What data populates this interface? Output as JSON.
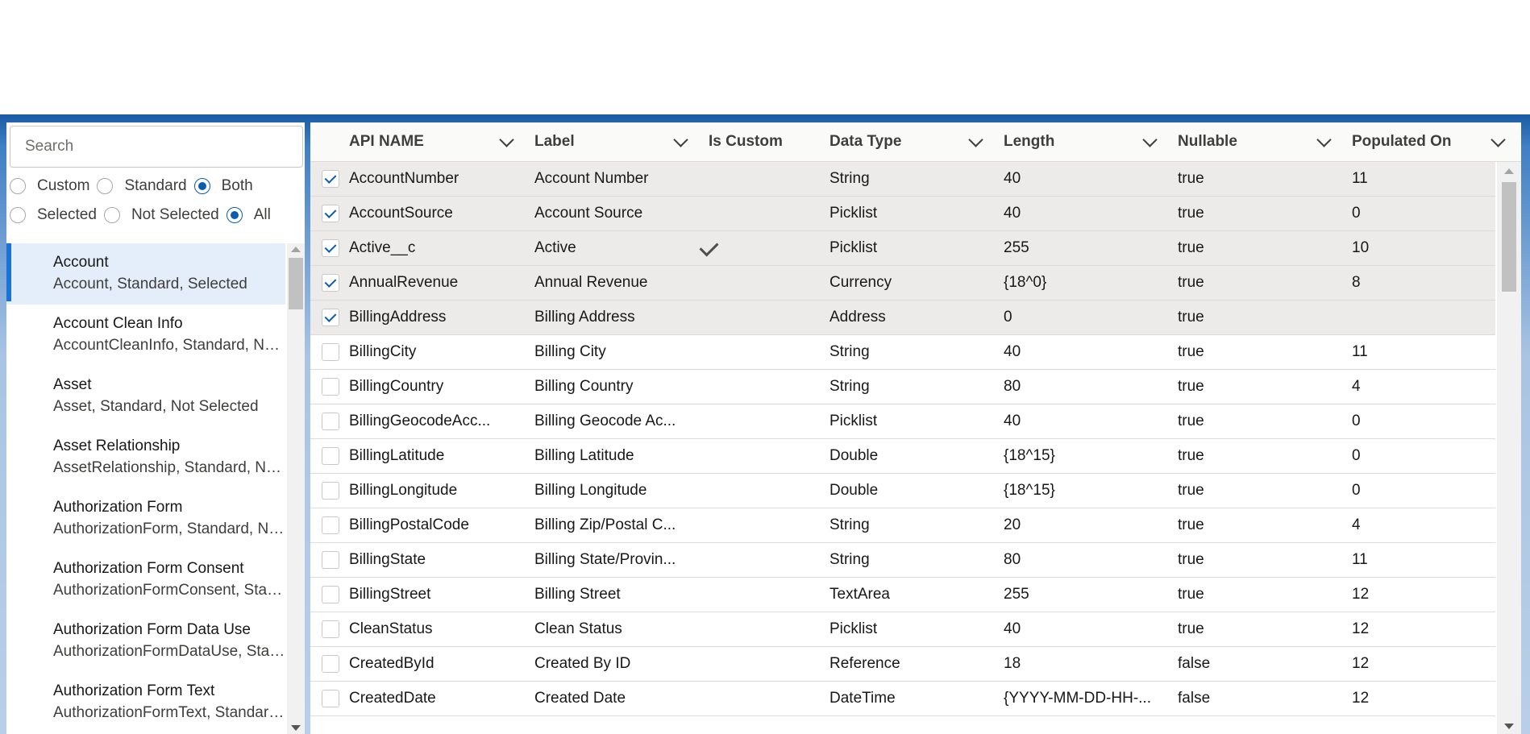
{
  "search": {
    "placeholder": "Search",
    "value": ""
  },
  "filters": {
    "type": [
      {
        "label": "Custom",
        "checked": false
      },
      {
        "label": "Standard",
        "checked": false
      },
      {
        "label": "Both",
        "checked": true
      }
    ],
    "selection": [
      {
        "label": "Selected",
        "checked": false
      },
      {
        "label": "Not Selected",
        "checked": false
      },
      {
        "label": "All",
        "checked": true
      }
    ]
  },
  "objects": [
    {
      "name": "Account",
      "desc": "Account, Standard, Selected",
      "active": true
    },
    {
      "name": "Account Clean Info",
      "desc": "AccountCleanInfo, Standard, Not Selected",
      "active": false
    },
    {
      "name": "Asset",
      "desc": "Asset, Standard, Not Selected",
      "active": false
    },
    {
      "name": "Asset Relationship",
      "desc": "AssetRelationship, Standard, Not Selected",
      "active": false
    },
    {
      "name": "Authorization Form",
      "desc": "AuthorizationForm, Standard, Not Selected",
      "active": false
    },
    {
      "name": "Authorization Form Consent",
      "desc": "AuthorizationFormConsent, Standard, Not Selected",
      "active": false
    },
    {
      "name": "Authorization Form Data Use",
      "desc": "AuthorizationFormDataUse, Standard, Not Selected",
      "active": false
    },
    {
      "name": "Authorization Form Text",
      "desc": "AuthorizationFormText, Standard, Not Selected",
      "active": false
    }
  ],
  "columns": [
    {
      "label": "API NAME",
      "sortable": true
    },
    {
      "label": "Label",
      "sortable": true
    },
    {
      "label": "Is Custom",
      "sortable": false
    },
    {
      "label": "Data Type",
      "sortable": true
    },
    {
      "label": "Length",
      "sortable": true
    },
    {
      "label": "Nullable",
      "sortable": true
    },
    {
      "label": "Populated On",
      "sortable": true
    }
  ],
  "rows": [
    {
      "selected": true,
      "api": "AccountNumber",
      "label": "Account Number",
      "custom": false,
      "type": "String",
      "length": "40",
      "nullable": "true",
      "populated": "11"
    },
    {
      "selected": true,
      "api": "AccountSource",
      "label": "Account Source",
      "custom": false,
      "type": "Picklist",
      "length": "40",
      "nullable": "true",
      "populated": "0"
    },
    {
      "selected": true,
      "api": "Active__c",
      "label": "Active",
      "custom": true,
      "type": "Picklist",
      "length": "255",
      "nullable": "true",
      "populated": "10"
    },
    {
      "selected": true,
      "api": "AnnualRevenue",
      "label": "Annual Revenue",
      "custom": false,
      "type": "Currency",
      "length": "{18^0}",
      "nullable": "true",
      "populated": "8"
    },
    {
      "selected": true,
      "api": "BillingAddress",
      "label": "Billing Address",
      "custom": false,
      "type": "Address",
      "length": "0",
      "nullable": "true",
      "populated": ""
    },
    {
      "selected": false,
      "api": "BillingCity",
      "label": "Billing City",
      "custom": false,
      "type": "String",
      "length": "40",
      "nullable": "true",
      "populated": "11"
    },
    {
      "selected": false,
      "api": "BillingCountry",
      "label": "Billing Country",
      "custom": false,
      "type": "String",
      "length": "80",
      "nullable": "true",
      "populated": "4"
    },
    {
      "selected": false,
      "api": "BillingGeocodeAcc...",
      "label": "Billing Geocode Ac...",
      "custom": false,
      "type": "Picklist",
      "length": "40",
      "nullable": "true",
      "populated": "0"
    },
    {
      "selected": false,
      "api": "BillingLatitude",
      "label": "Billing Latitude",
      "custom": false,
      "type": "Double",
      "length": "{18^15}",
      "nullable": "true",
      "populated": "0"
    },
    {
      "selected": false,
      "api": "BillingLongitude",
      "label": "Billing Longitude",
      "custom": false,
      "type": "Double",
      "length": "{18^15}",
      "nullable": "true",
      "populated": "0"
    },
    {
      "selected": false,
      "api": "BillingPostalCode",
      "label": "Billing Zip/Postal C...",
      "custom": false,
      "type": "String",
      "length": "20",
      "nullable": "true",
      "populated": "4"
    },
    {
      "selected": false,
      "api": "BillingState",
      "label": "Billing State/Provin...",
      "custom": false,
      "type": "String",
      "length": "80",
      "nullable": "true",
      "populated": "11"
    },
    {
      "selected": false,
      "api": "BillingStreet",
      "label": "Billing Street",
      "custom": false,
      "type": "TextArea",
      "length": "255",
      "nullable": "true",
      "populated": "12"
    },
    {
      "selected": false,
      "api": "CleanStatus",
      "label": "Clean Status",
      "custom": false,
      "type": "Picklist",
      "length": "40",
      "nullable": "true",
      "populated": "12"
    },
    {
      "selected": false,
      "api": "CreatedById",
      "label": "Created By ID",
      "custom": false,
      "type": "Reference",
      "length": "18",
      "nullable": "false",
      "populated": "12"
    },
    {
      "selected": false,
      "api": "CreatedDate",
      "label": "Created Date",
      "custom": false,
      "type": "DateTime",
      "length": "{YYYY-MM-DD-HH-...",
      "nullable": "false",
      "populated": "12"
    }
  ]
}
